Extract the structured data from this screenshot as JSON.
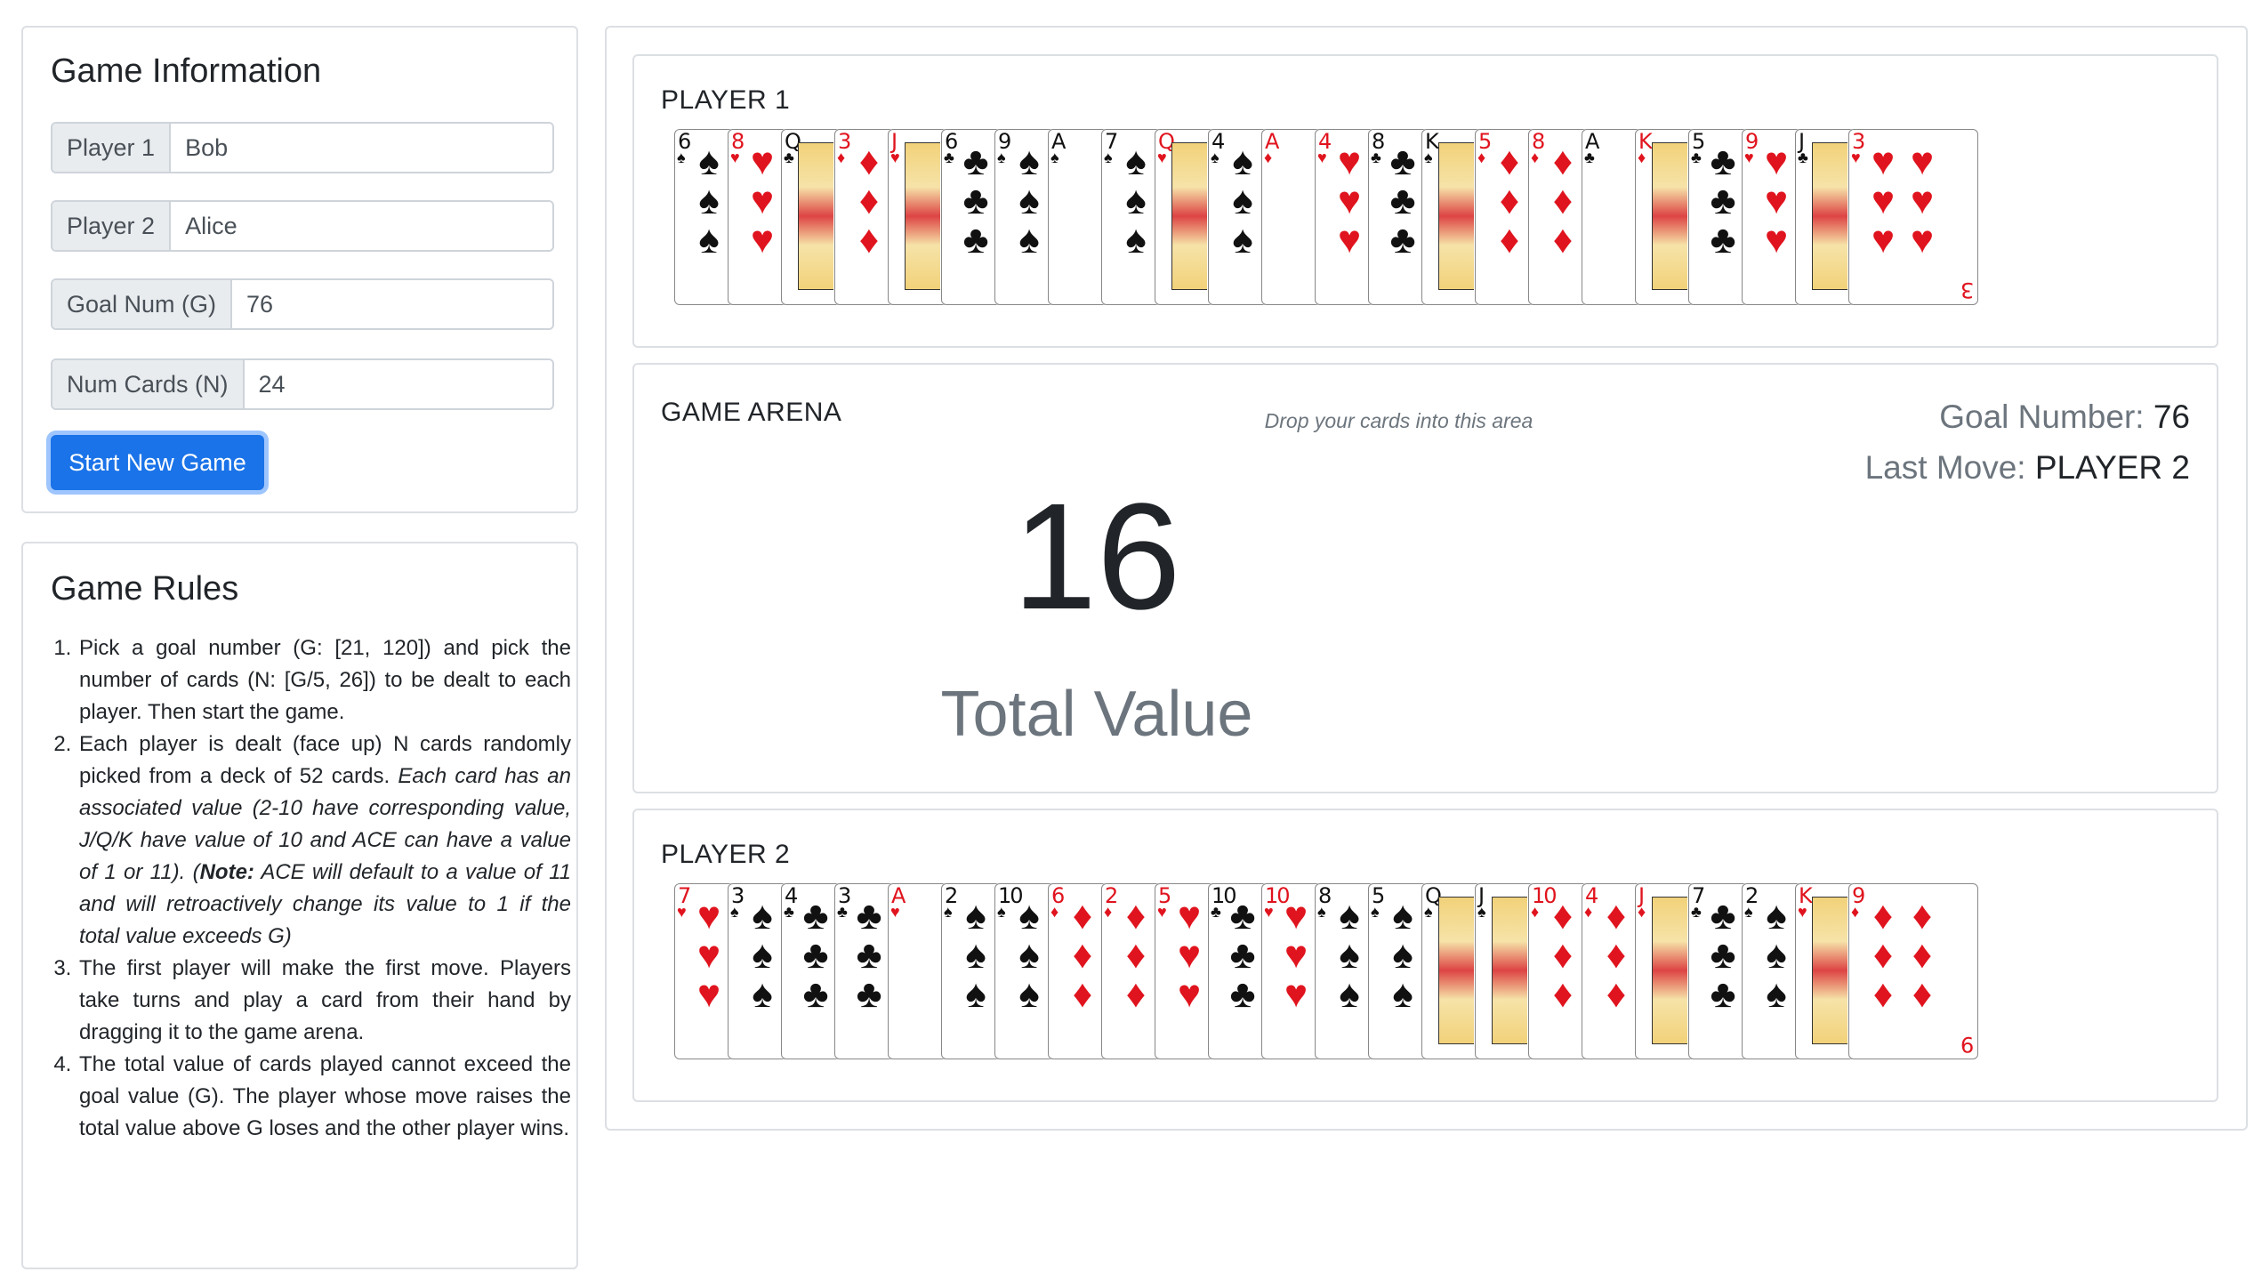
{
  "game_info": {
    "title": "Game Information",
    "player1_label": "Player 1",
    "player1_value": "Bob",
    "player2_label": "Player 2",
    "player2_value": "Alice",
    "goal_label": "Goal Num (G)",
    "goal_value": "76",
    "num_cards_label": "Num Cards (N)",
    "num_cards_value": "24",
    "start_button": "Start New Game"
  },
  "rules": {
    "title": "Game Rules",
    "r1": "Pick a goal number (G: [21, 120]) and pick the number of cards (N: [G/5, 26]) to be dealt to each player. Then start the game.",
    "r2_plain": "Each player is dealt (face up) N cards randomly picked from a deck of 52 cards.",
    "r2_italic": "Each card has an associated value (2-10 have corresponding value, J/Q/K have value of 10 and ACE can have a value of 1 or 11).",
    "r2_note_label": "Note:",
    "r2_note_text": "ACE will default to a value of 11 and will retroactively change its value to 1 if the total value exceeds G)",
    "r3": "The first player will make the first move. Players take turns and play a card from their hand by dragging it to the game arena.",
    "r4": "The total value of cards played cannot exceed the goal value (G). The player whose move raises the total value above G loses and the other player wins."
  },
  "player1": {
    "label": "PLAYER 1",
    "cards": [
      {
        "rank": "6",
        "suit": "♠"
      },
      {
        "rank": "8",
        "suit": "♥"
      },
      {
        "rank": "Q",
        "suit": "♣"
      },
      {
        "rank": "3",
        "suit": "♦"
      },
      {
        "rank": "J",
        "suit": "♥"
      },
      {
        "rank": "6",
        "suit": "♣"
      },
      {
        "rank": "9",
        "suit": "♠"
      },
      {
        "rank": "A",
        "suit": "♠"
      },
      {
        "rank": "7",
        "suit": "♠"
      },
      {
        "rank": "Q",
        "suit": "♥"
      },
      {
        "rank": "4",
        "suit": "♠"
      },
      {
        "rank": "A",
        "suit": "♦"
      },
      {
        "rank": "4",
        "suit": "♥"
      },
      {
        "rank": "8",
        "suit": "♣"
      },
      {
        "rank": "K",
        "suit": "♠"
      },
      {
        "rank": "5",
        "suit": "♦"
      },
      {
        "rank": "8",
        "suit": "♦"
      },
      {
        "rank": "A",
        "suit": "♣"
      },
      {
        "rank": "K",
        "suit": "♦"
      },
      {
        "rank": "5",
        "suit": "♣"
      },
      {
        "rank": "9",
        "suit": "♥"
      },
      {
        "rank": "J",
        "suit": "♣"
      },
      {
        "rank": "3",
        "suit": "♥"
      }
    ]
  },
  "arena": {
    "label": "GAME ARENA",
    "drop_hint": "Drop your cards into this area",
    "goal_label": "Goal Number: ",
    "goal_value": "76",
    "last_move_label": "Last Move: ",
    "last_move_value": "PLAYER 2",
    "total_value": "16",
    "total_label": "Total Value"
  },
  "player2": {
    "label": "PLAYER 2",
    "cards": [
      {
        "rank": "7",
        "suit": "♥"
      },
      {
        "rank": "3",
        "suit": "♠"
      },
      {
        "rank": "4",
        "suit": "♣"
      },
      {
        "rank": "3",
        "suit": "♣"
      },
      {
        "rank": "A",
        "suit": "♥"
      },
      {
        "rank": "2",
        "suit": "♠"
      },
      {
        "rank": "10",
        "suit": "♠"
      },
      {
        "rank": "6",
        "suit": "♦"
      },
      {
        "rank": "2",
        "suit": "♦"
      },
      {
        "rank": "5",
        "suit": "♥"
      },
      {
        "rank": "10",
        "suit": "♣"
      },
      {
        "rank": "10",
        "suit": "♥"
      },
      {
        "rank": "8",
        "suit": "♠"
      },
      {
        "rank": "5",
        "suit": "♠"
      },
      {
        "rank": "Q",
        "suit": "♠"
      },
      {
        "rank": "J",
        "suit": "♠"
      },
      {
        "rank": "10",
        "suit": "♦"
      },
      {
        "rank": "4",
        "suit": "♦"
      },
      {
        "rank": "J",
        "suit": "♦"
      },
      {
        "rank": "7",
        "suit": "♣"
      },
      {
        "rank": "2",
        "suit": "♠"
      },
      {
        "rank": "K",
        "suit": "♥"
      },
      {
        "rank": "9",
        "suit": "♦"
      }
    ]
  },
  "colors": {
    "primary": "#1a73e8",
    "red_suit": "#e0141e",
    "muted": "#6c757d",
    "border": "#dcdfe3"
  }
}
